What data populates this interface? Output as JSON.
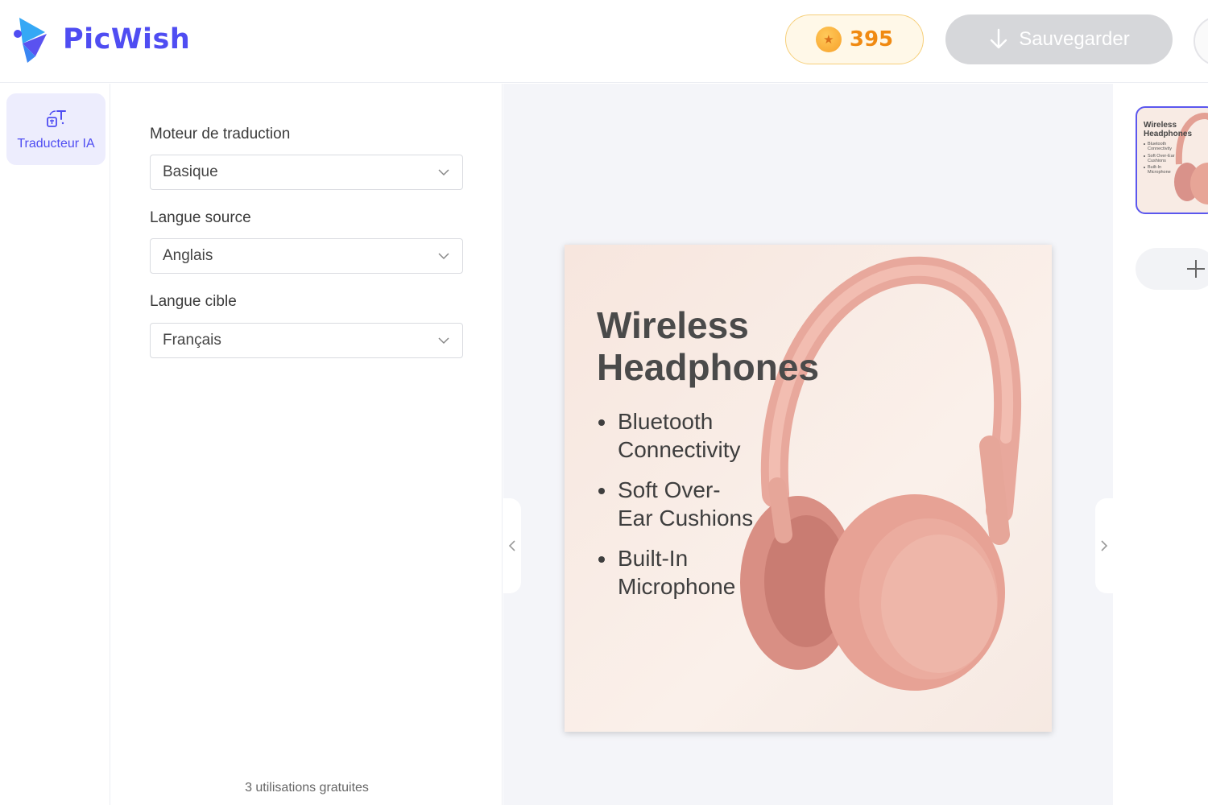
{
  "app": {
    "brand": "PicWish",
    "brand_color": "#4f4df2"
  },
  "header": {
    "coins": "395",
    "save_label": "Sauvegarder"
  },
  "rail": {
    "items": [
      {
        "label": "Traducteur IA",
        "icon": "translate-icon",
        "active": true
      }
    ]
  },
  "panel": {
    "engine_label": "Moteur de traduction",
    "engine_value": "Basique",
    "source_label": "Langue source",
    "source_value": "Anglais",
    "target_label": "Langue cible",
    "target_value": "Français",
    "free_uses": "3 utilisations gratuites"
  },
  "poster": {
    "title_line1": "Wireless",
    "title_line2": "Headphones",
    "bullets": [
      {
        "line1": "Bluetooth",
        "line2": "Connectivity"
      },
      {
        "line1": "Soft Over-",
        "line2": "Ear Cushions"
      },
      {
        "line1": "Built-In",
        "line2": "Microphone"
      }
    ]
  },
  "thumbnail": {
    "title_line1": "Wireless",
    "title_line2": "Headphones",
    "bullets": [
      "Bluetooth Connectivity",
      "Soft Over-Ear Cushions",
      "Built-In Microphone"
    ]
  }
}
